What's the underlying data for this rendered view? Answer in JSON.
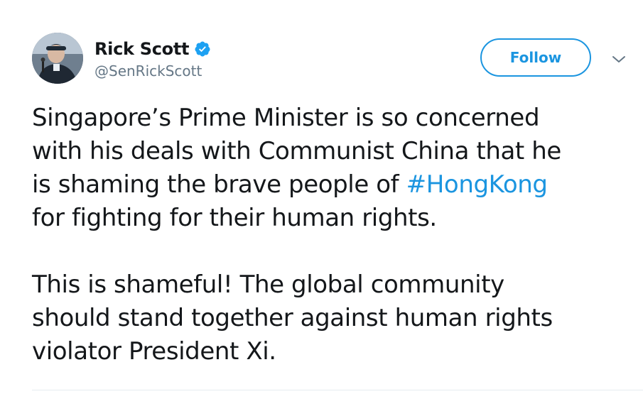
{
  "author": {
    "display_name": "Rick Scott",
    "handle": "@SenRickScott",
    "verified": true,
    "avatar_icon": "avatar-photo"
  },
  "actions": {
    "follow_label": "Follow",
    "menu_icon": "chevron-down-icon"
  },
  "tweet": {
    "paragraph1": {
      "line1": "Singapore’s Prime Minister is so concerned",
      "line2": "with his deals with Communist China that he",
      "line3_prefix": "is shaming the brave people of ",
      "hashtag": "#HongKong",
      "line4": "for fighting for their human rights."
    },
    "paragraph2": {
      "line1": "This is shameful! The global community",
      "line2": "should stand together against human rights",
      "line3": "violator President Xi."
    }
  },
  "colors": {
    "text": "#14171a",
    "secondary": "#657786",
    "accent": "#1b95e0",
    "divider": "#e6ecf0"
  }
}
